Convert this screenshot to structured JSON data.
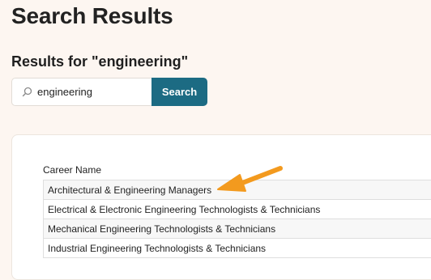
{
  "page": {
    "title": "Search Results",
    "results_heading": "Results for \"engineering\""
  },
  "search": {
    "icon": "search-icon",
    "value": "engineering",
    "button_label": "Search"
  },
  "results": {
    "column_header": "Career Name",
    "rows": [
      {
        "label": "Architectural & Engineering Managers"
      },
      {
        "label": "Electrical & Electronic Engineering Technologists & Technicians"
      },
      {
        "label": "Mechanical Engineering Technologists & Technicians"
      },
      {
        "label": "Industrial Engineering Technologists & Technicians"
      }
    ]
  },
  "annotation": {
    "icon": "arrow-icon",
    "color": "#f39a1e"
  },
  "colors": {
    "background": "#fdf6f1",
    "accent": "#1c6b83"
  }
}
